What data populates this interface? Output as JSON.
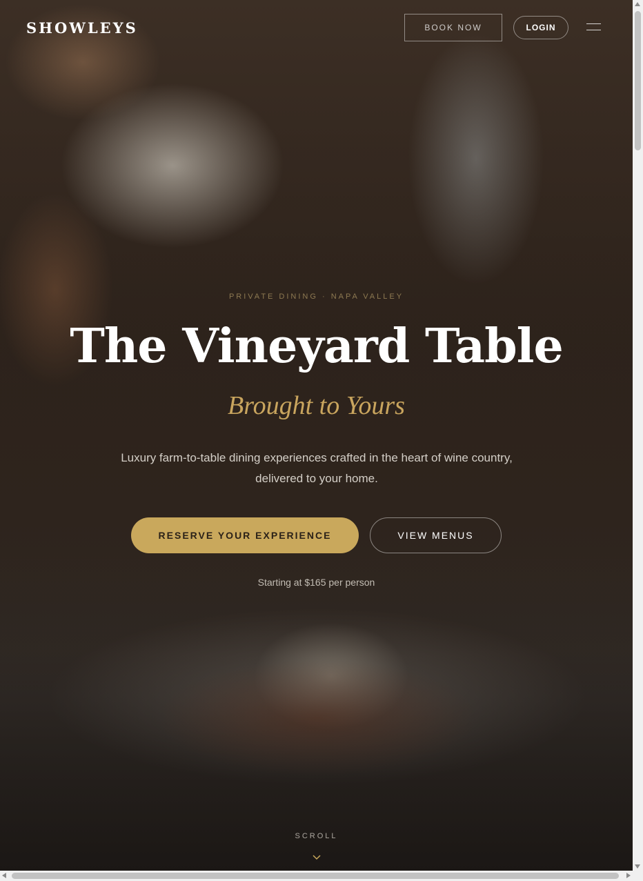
{
  "header": {
    "logo": "SHOWLEYS",
    "book_label": "BOOK NOW",
    "login_label": "LOGIN",
    "menu_icon": "hamburger-menu-icon"
  },
  "hero": {
    "kicker": "PRIVATE DINING · NAPA VALLEY",
    "title": "The Vineyard Table",
    "subtitle": "Brought to Yours",
    "description": "Luxury farm-to-table dining experiences crafted in the heart of wine country, delivered to your home.",
    "primary_cta": "RESERVE YOUR EXPERIENCE",
    "secondary_cta": "VIEW MENUS",
    "price_note": "Starting at $165 per person",
    "scroll_label": "SCROLL",
    "scroll_icon": "chevron-down-icon"
  },
  "colors": {
    "accent_gold": "#c9a85c",
    "subtitle_gold": "#c9a55e",
    "text_light": "#ffffff"
  }
}
